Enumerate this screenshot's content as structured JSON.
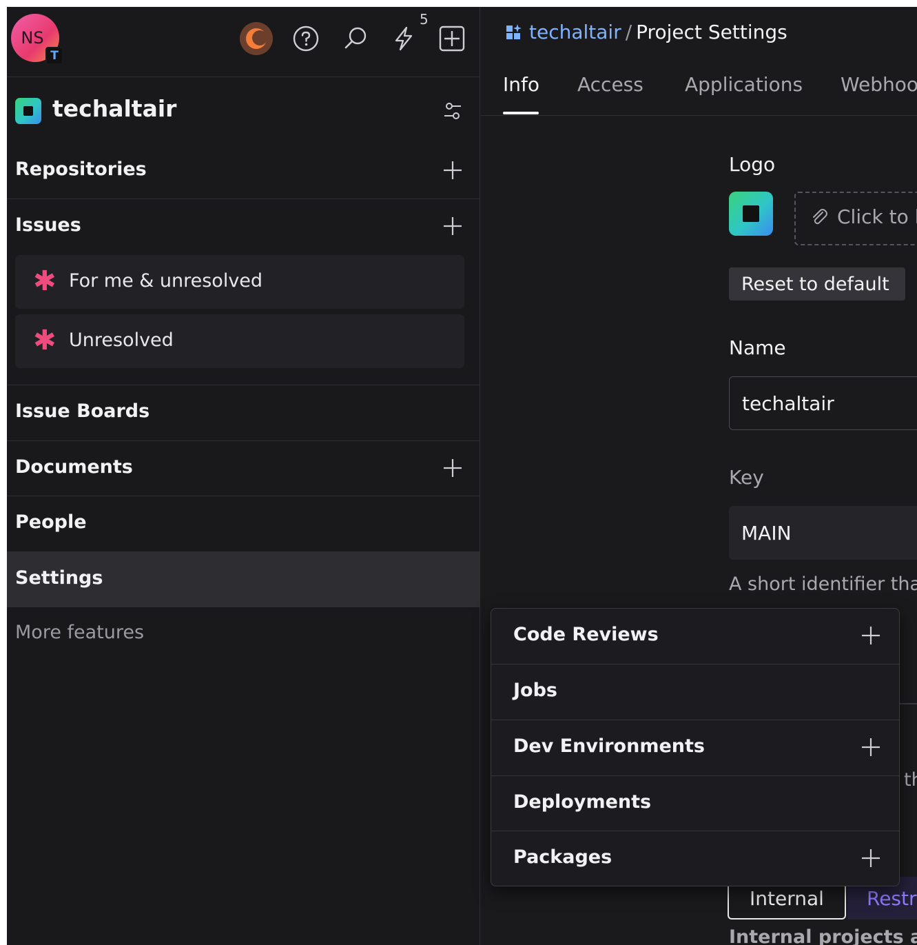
{
  "user": {
    "initials": "NS",
    "badge": "T"
  },
  "topbar": {
    "notifications_count": "5"
  },
  "project": {
    "name": "techaltair"
  },
  "sidebar": {
    "sections": [
      {
        "label": "Repositories"
      },
      {
        "label": "Issues"
      },
      {
        "label": "Issue Boards"
      },
      {
        "label": "Documents"
      },
      {
        "label": "People"
      },
      {
        "label": "Settings"
      }
    ],
    "issue_items": [
      {
        "label": "For me & unresolved"
      },
      {
        "label": "Unresolved"
      }
    ],
    "more_features": "More features"
  },
  "main": {
    "breadcrumb": {
      "project": "techaltair",
      "separator": "/",
      "current": "Project Settings"
    },
    "tabs": [
      {
        "label": "Info"
      },
      {
        "label": "Access"
      },
      {
        "label": "Applications"
      },
      {
        "label": "Webhoo"
      }
    ],
    "logo": {
      "label": "Logo",
      "upload_text": "Click to l",
      "reset_label": "Reset to default"
    },
    "name_field": {
      "label": "Name",
      "value": "techaltair"
    },
    "key_field": {
      "label": "Key",
      "value": "MAIN",
      "helper": "A short identifier that"
    },
    "partial_text": "th",
    "visibility": {
      "internal": "Internal",
      "restricted": "Restri"
    },
    "bottom_note": "Internal projects are"
  },
  "dropdown": {
    "items": [
      {
        "label": "Code Reviews"
      },
      {
        "label": "Jobs"
      },
      {
        "label": "Dev Environments"
      },
      {
        "label": "Deployments"
      },
      {
        "label": "Packages"
      }
    ]
  }
}
